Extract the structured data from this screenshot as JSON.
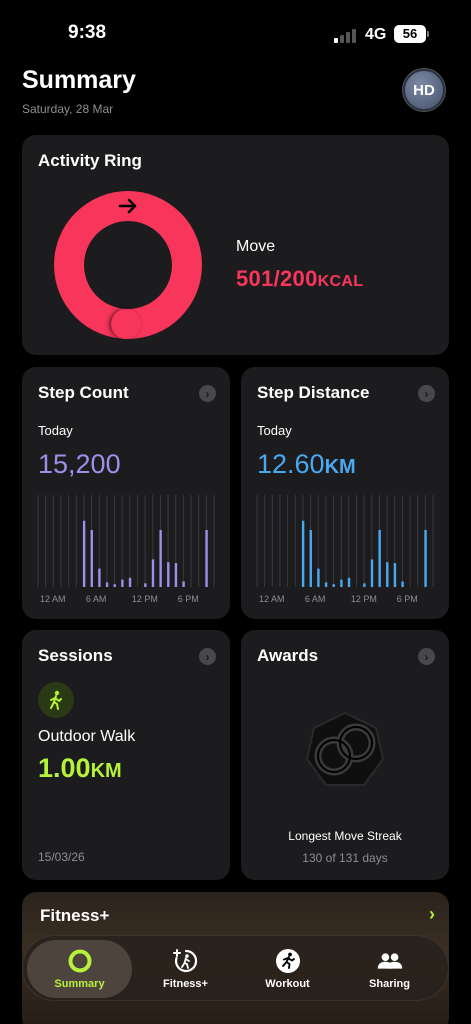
{
  "status_bar": {
    "time": "9:38",
    "network": "4G",
    "battery": "56"
  },
  "header": {
    "title": "Summary",
    "date": "Saturday, 28 Mar",
    "avatar_initials": "HD"
  },
  "activity": {
    "title": "Activity Ring",
    "move_label": "Move",
    "move_value": "501/200",
    "move_unit": "KCAL",
    "move_progress": 2.505,
    "ring_color": "#f8365c",
    "arrow_icon": "arrow-right-icon"
  },
  "steps": {
    "title": "Step Count",
    "period": "Today",
    "value": "15,200",
    "color": "#a18ee8",
    "chart_data": {
      "type": "bar",
      "x_ticks": [
        "12 AM",
        "6 AM",
        "12 PM",
        "6 PM"
      ],
      "hourly": [
        0,
        0,
        0,
        0,
        0,
        0,
        0.72,
        0.62,
        0.2,
        0.05,
        0.03,
        0.08,
        0.1,
        0,
        0.04,
        0.3,
        0.62,
        0.27,
        0.26,
        0.06,
        0,
        0,
        0.62,
        0
      ],
      "grid": true
    }
  },
  "distance": {
    "title": "Step Distance",
    "period": "Today",
    "value": "12.60",
    "unit": "KM",
    "color": "#4aa8f0",
    "chart_data": {
      "type": "bar",
      "x_ticks": [
        "12 AM",
        "6 AM",
        "12 PM",
        "6 PM"
      ],
      "hourly": [
        0,
        0,
        0,
        0,
        0,
        0,
        0.72,
        0.62,
        0.2,
        0.05,
        0.03,
        0.08,
        0.1,
        0,
        0.04,
        0.3,
        0.62,
        0.27,
        0.26,
        0.06,
        0,
        0,
        0.62,
        0
      ],
      "grid": true
    }
  },
  "sessions": {
    "title": "Sessions",
    "activity_icon": "walking-icon",
    "name": "Outdoor Walk",
    "value": "1.00",
    "unit": "KM",
    "date": "15/03/26",
    "color": "#b6f23a"
  },
  "awards": {
    "title": "Awards",
    "badge_icon": "move-streak-badge-icon",
    "name": "Longest Move Streak",
    "detail": "130 of 131 days"
  },
  "fitness_plus": {
    "brand": "Fitness+",
    "apple_symbol": ""
  },
  "tabs": [
    {
      "label": "Summary",
      "icon": "activity-ring-icon",
      "active": true
    },
    {
      "label": "Fitness+",
      "icon": "fitness-plus-icon",
      "active": false
    },
    {
      "label": "Workout",
      "icon": "workout-runner-icon",
      "active": false
    },
    {
      "label": "Sharing",
      "icon": "people-icon",
      "active": false
    }
  ]
}
